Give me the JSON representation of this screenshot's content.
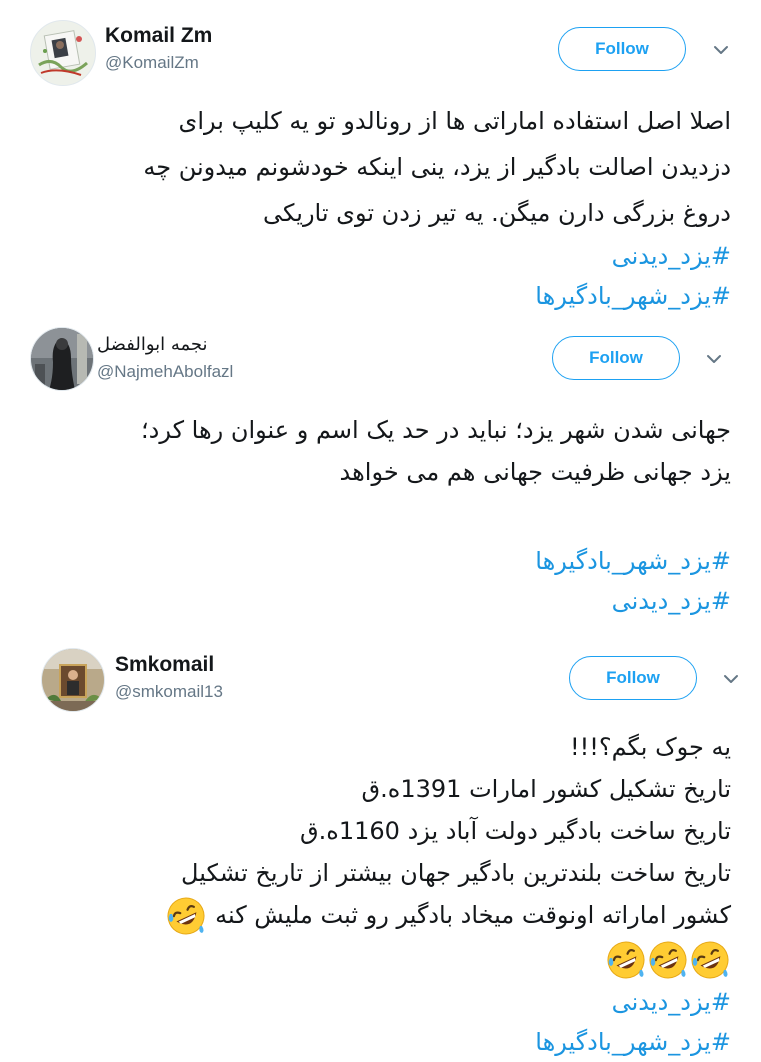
{
  "tweets": [
    {
      "name": "Komail Zm",
      "handle": "@KomailZm",
      "follow_label": "Follow",
      "lines": [
        "اصلا اصل استفاده اماراتی ها از رونالدو تو یه کلیپ برای",
        "دزدیدن اصالت بادگیر از یزد، ینی اینکه خودشونم میدونن چه",
        "دروغ بزرگی دارن میگن. یه تیر زدن توی تاریکی"
      ],
      "hashtags": [
        "#یزد_دیدنی",
        "#یزد_شهر_بادگیرها"
      ]
    },
    {
      "name": "نجمه ابوالفضل",
      "handle": "@NajmehAbolfazl",
      "follow_label": "Follow",
      "lines": [
        "جهانی شدن شهر یزد؛ نباید در حد یک اسم و عنوان رها کرد؛",
        "یزد جهانی ظرفیت جهانی هم می خواهد"
      ],
      "hashtags": [
        "#یزد_شهر_بادگیرها",
        "#یزد_دیدنی"
      ]
    },
    {
      "name": "Smkomail",
      "handle": "@smkomail13",
      "follow_label": "Follow",
      "lines": [
        "یه جوک بگم؟!!!",
        "تاریخ تشکیل کشور امارات 1391ه.ق",
        "تاریخ ساخت بادگیر دولت آباد یزد 1160ه.ق",
        "تاریخ ساخت بلندترین بادگیر جهان بیشتر از تاریخ تشکیل",
        "کشور اماراته اونوقت میخاد بادگیر رو ثبت ملیش کنه"
      ],
      "emoji_icon": "rolling-on-floor-laughing-emoji",
      "hashtags": [
        "#یزد_دیدنی",
        "#یزد_شهر_بادگیرها"
      ]
    }
  ],
  "colors": {
    "accent": "#1da1f2",
    "hashtag": "#1b95e0",
    "handle": "#657786",
    "text": "#14171a"
  }
}
